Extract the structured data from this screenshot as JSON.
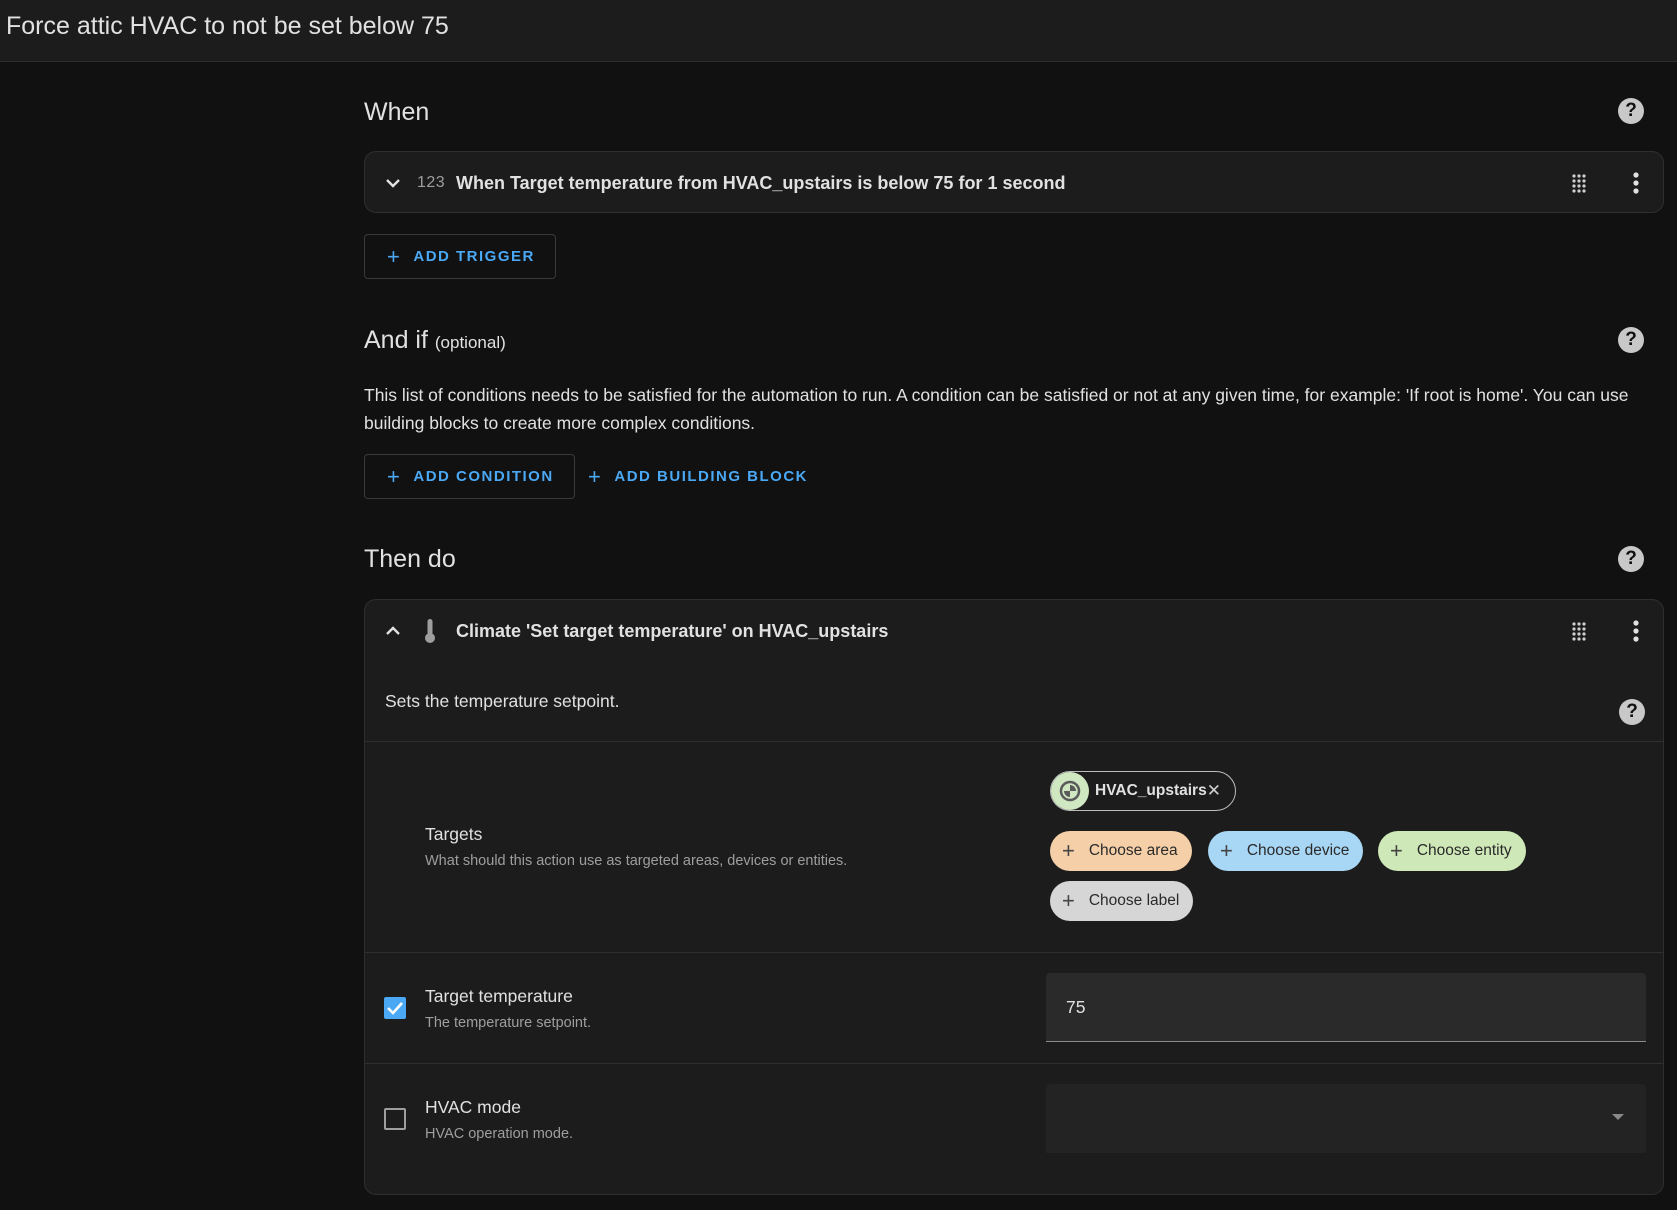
{
  "header": {
    "title": "Force attic HVAC to not be set below 75"
  },
  "when": {
    "heading": "When",
    "trigger": {
      "icon_text": "123",
      "label": "When Target temperature from HVAC_upstairs is below 75 for 1 second"
    },
    "add_trigger_label": "ADD TRIGGER"
  },
  "and_if": {
    "heading": "And if",
    "optional": "(optional)",
    "description": "This list of conditions needs to be satisfied for the automation to run. A condition can be satisfied or not at any given time, for example: 'If root is home'. You can use building blocks to create more complex conditions.",
    "add_condition_label": "ADD CONDITION",
    "add_building_block_label": "ADD BUILDING BLOCK"
  },
  "then_do": {
    "heading": "Then do",
    "action": {
      "label": "Climate 'Set target temperature' on HVAC_upstairs",
      "description": "Sets the temperature setpoint.",
      "targets": {
        "label": "Targets",
        "help": "What should this action use as targeted areas, devices or entities.",
        "entity": "HVAC_upstairs",
        "choose_area": "Choose area",
        "choose_device": "Choose device",
        "choose_entity": "Choose entity",
        "choose_label": "Choose label"
      },
      "target_temperature": {
        "label": "Target temperature",
        "help": "The temperature setpoint.",
        "value": "75",
        "checked": true
      },
      "hvac_mode": {
        "label": "HVAC mode",
        "help": "HVAC operation mode.",
        "value": "",
        "checked": false
      }
    }
  },
  "colors": {
    "accent": "#4aa8f5",
    "area_chip": "#f5cfa8",
    "device_chip": "#a8d6f5",
    "entity_chip": "#cfe8b8",
    "label_chip": "#d6d6d6"
  },
  "icons": {
    "help": "help-circle-icon",
    "expand": "chevron-down-icon",
    "collapse": "chevron-up-icon",
    "drag": "drag-handle-icon",
    "menu": "dots-vertical-icon",
    "thermometer": "thermometer-icon",
    "hvac": "hvac-icon",
    "close": "close-icon",
    "check": "check-icon",
    "dropdown": "menu-down-icon"
  }
}
